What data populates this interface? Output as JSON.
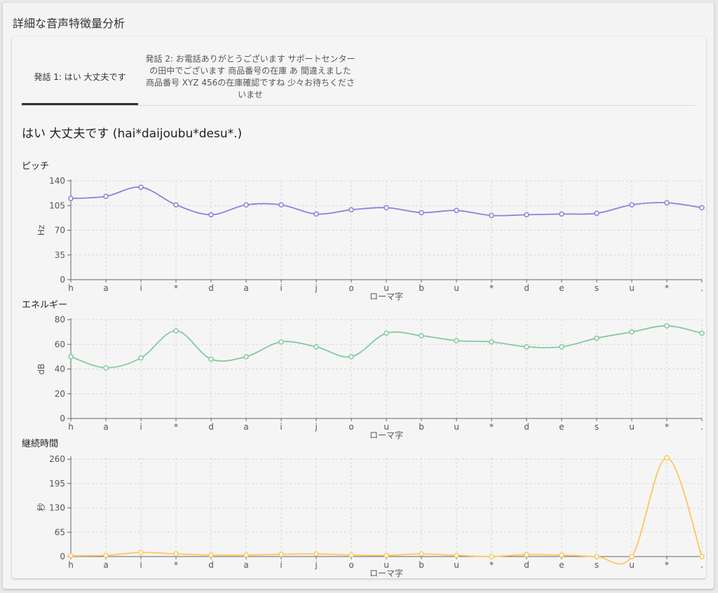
{
  "page_title": "詳細な音声特徴量分析",
  "tabs": [
    {
      "label": "発話 1: はい 大丈夫です",
      "active": true
    },
    {
      "label": "発話 2: お電話ありがとうございます サポートセンターの田中でございます 商品番号の在庫 あ 間違えました 商品番号 XYZ 456の在庫確認ですね 少々お待ちくださいませ",
      "active": false
    }
  ],
  "utterance_heading": "はい 大丈夫です (hai*daijoubu*desu*.)",
  "colors": {
    "pitch": "#8884d8",
    "energy": "#82ca9d",
    "duration": "#ffc658"
  },
  "chart_data": [
    {
      "type": "line",
      "title": "ピッチ",
      "xlabel": "ローマ字",
      "ylabel": "Hz",
      "categories": [
        "h",
        "a",
        "i",
        "*",
        "d",
        "a",
        "i",
        "j",
        "o",
        "u",
        "b",
        "u",
        "*",
        "d",
        "e",
        "s",
        "u",
        "*",
        "."
      ],
      "values": [
        115,
        118,
        131,
        106,
        92,
        106,
        106,
        93,
        99,
        102,
        95,
        98,
        91,
        92,
        93,
        94,
        106,
        109,
        102
      ],
      "yticks": [
        0,
        35,
        70,
        105,
        140
      ],
      "ylim": [
        0,
        140
      ],
      "grid": true
    },
    {
      "type": "line",
      "title": "エネルギー",
      "xlabel": "ローマ字",
      "ylabel": "dB",
      "categories": [
        "h",
        "a",
        "i",
        "*",
        "d",
        "a",
        "i",
        "j",
        "o",
        "u",
        "b",
        "u",
        "*",
        "d",
        "e",
        "s",
        "u",
        "*",
        "."
      ],
      "values": [
        50,
        41,
        49,
        71,
        48,
        50,
        62,
        58,
        50,
        69,
        67,
        63,
        62,
        58,
        58,
        65,
        70,
        75,
        69
      ],
      "yticks": [
        0,
        20,
        40,
        60,
        80
      ],
      "ylim": [
        0,
        80
      ],
      "grid": true
    },
    {
      "type": "line",
      "title": "継続時間",
      "xlabel": "ローマ字",
      "ylabel": "秒",
      "categories": [
        "h",
        "a",
        "i",
        "*",
        "d",
        "a",
        "i",
        "j",
        "o",
        "u",
        "b",
        "u",
        "*",
        "d",
        "e",
        "s",
        "u",
        "*",
        "."
      ],
      "values": [
        2,
        3,
        11,
        7,
        4,
        4,
        6,
        7,
        4,
        3,
        7,
        3,
        0,
        5,
        4,
        0,
        0,
        264,
        0
      ],
      "yticks": [
        0,
        65,
        130,
        195,
        260
      ],
      "ylim": [
        0,
        264
      ],
      "grid": true
    }
  ]
}
